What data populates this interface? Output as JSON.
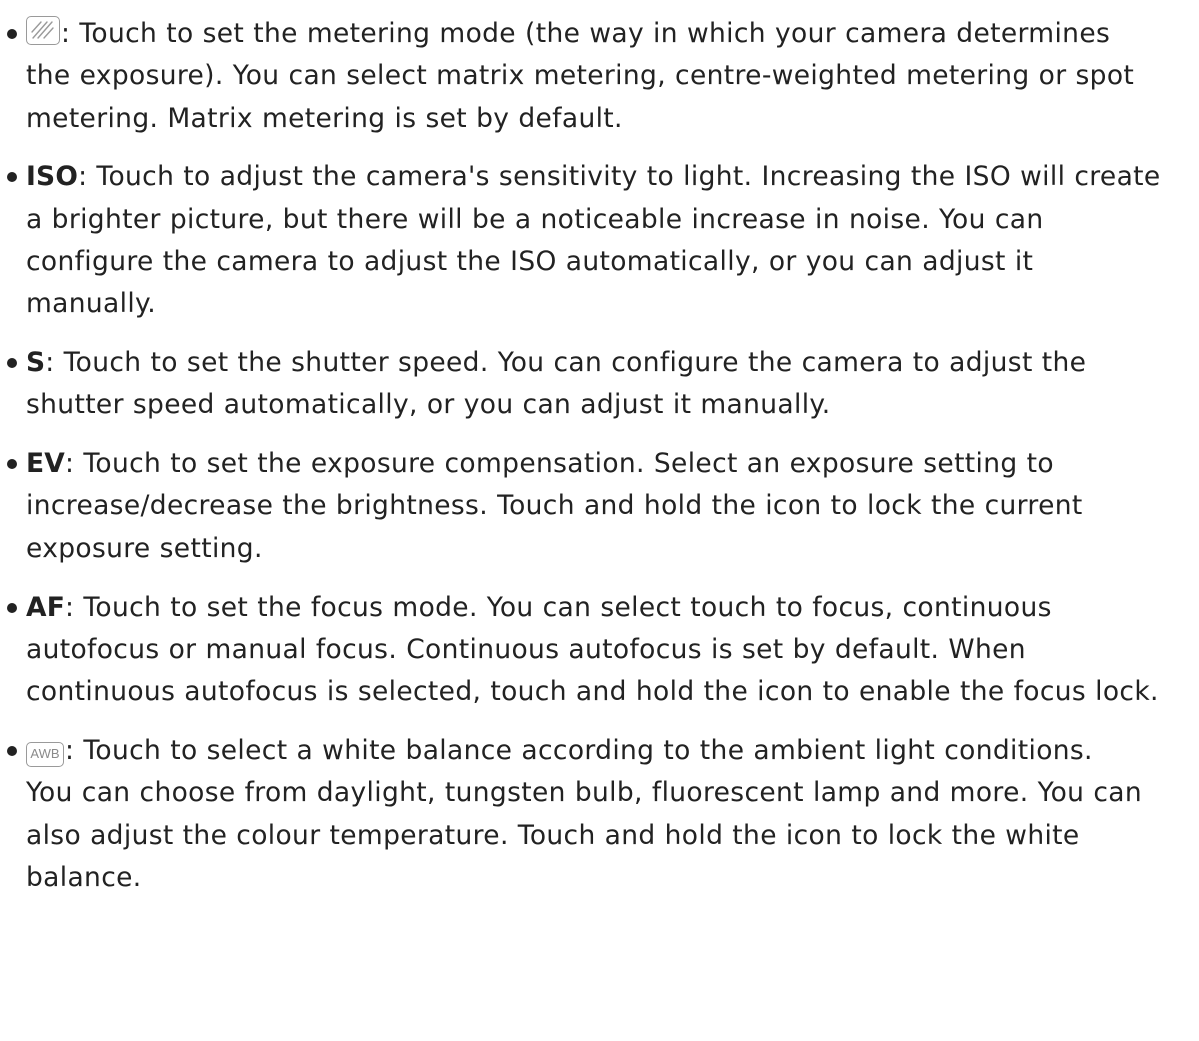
{
  "items": [
    {
      "icon": "metering-icon",
      "lines": [
        ": Touch to set the metering mode (the way in which your camera determines",
        "the exposure). You can select matrix metering, centre-weighted metering or spot",
        "metering. Matrix metering is set by default."
      ]
    },
    {
      "term": "ISO",
      "lines": [
        ": Touch to adjust the camera's sensitivity to light. Increasing the ISO will create",
        "a brighter picture, but there will be a noticeable increase in noise. You can",
        "configure the camera to adjust the ISO automatically, or you can adjust it",
        "manually."
      ]
    },
    {
      "term": "S",
      "lines": [
        ": Touch to set the shutter speed. You can configure the camera to adjust the",
        "shutter speed automatically, or you can adjust it manually."
      ]
    },
    {
      "term": "EV",
      "lines": [
        ": Touch to set the exposure compensation. Select an exposure setting to",
        "increase/decrease the brightness. Touch and hold the icon to lock the current",
        "exposure setting."
      ]
    },
    {
      "term": "AF",
      "lines": [
        ": Touch to set the focus mode. You can select touch to focus, continuous",
        "autofocus or manual focus. Continuous autofocus is set by default. When",
        "continuous autofocus is selected, touch and hold the icon to enable the focus lock."
      ]
    },
    {
      "icon": "awb-icon",
      "icon_text": "AWB",
      "lines": [
        ": Touch to select a white balance according to the ambient light conditions.",
        "You can choose from daylight, tungsten bulb, fluorescent lamp and more. You can",
        "also adjust the colour temperature. Touch and hold the icon to lock the white",
        "balance."
      ]
    }
  ]
}
